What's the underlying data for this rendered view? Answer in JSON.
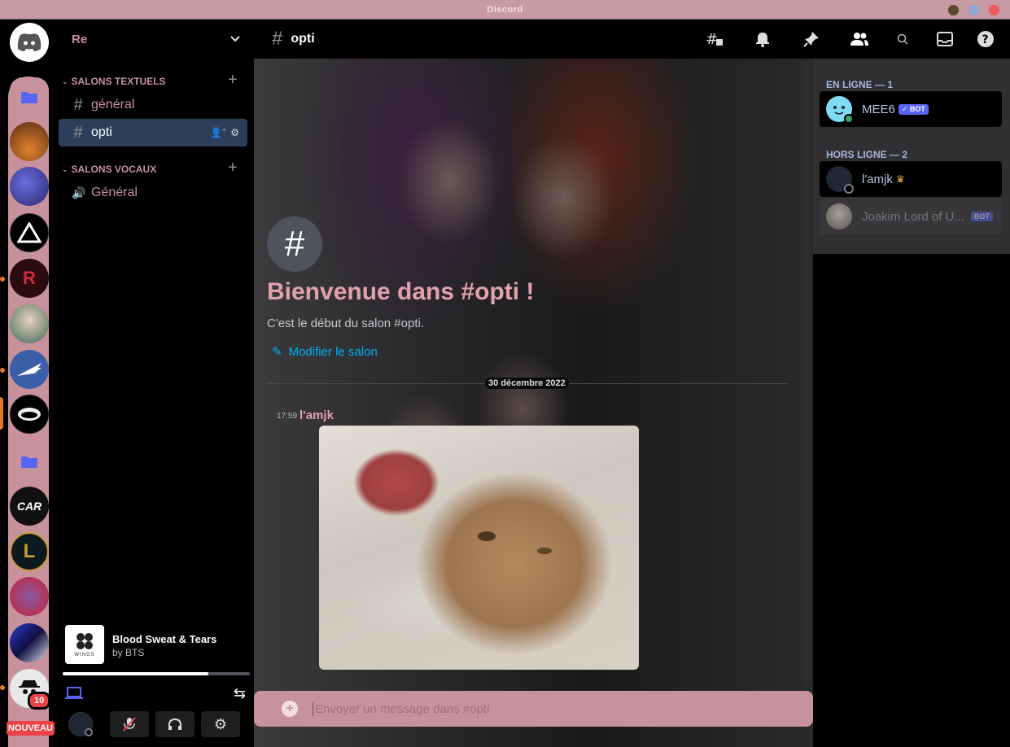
{
  "window": {
    "title": "Discord"
  },
  "servers": {
    "badge_count": "10",
    "new_label": "NOUVEAU"
  },
  "guild": {
    "name": "Re"
  },
  "categories": {
    "text": "SALONS TEXTUELS",
    "voice": "SALONS VOCAUX"
  },
  "channels": {
    "general_text": "général",
    "opti": "opti",
    "general_voice": "Général"
  },
  "header": {
    "channel_name": "opti"
  },
  "welcome": {
    "title": "Bienvenue dans #opti !",
    "subtitle": "C'est le début du salon #opti.",
    "edit_link": "Modifier le salon"
  },
  "messages": {
    "date_divider": "30 décembre 2022",
    "time": "17:59",
    "author": "l'amjk"
  },
  "composer": {
    "placeholder": "Envoyer un message dans #opti"
  },
  "music": {
    "track": "Blood Sweat & Tears",
    "artist": "by BTS",
    "album_label": "WINGS",
    "progress": 0.78
  },
  "members": {
    "online_header": "EN LIGNE — 1",
    "offline_header": "HORS LIGNE — 2",
    "list": [
      {
        "name": "MEE6",
        "badge": "✓ BOT"
      },
      {
        "name": "l'amjk"
      },
      {
        "name": "Joakim Lord of U...",
        "badge": "BOT"
      }
    ]
  },
  "colors": {
    "accent_pink": "#c8929c",
    "brand_blurple": "#5865f2",
    "link_blue": "#00aff4",
    "online_green": "#3ba55d"
  }
}
